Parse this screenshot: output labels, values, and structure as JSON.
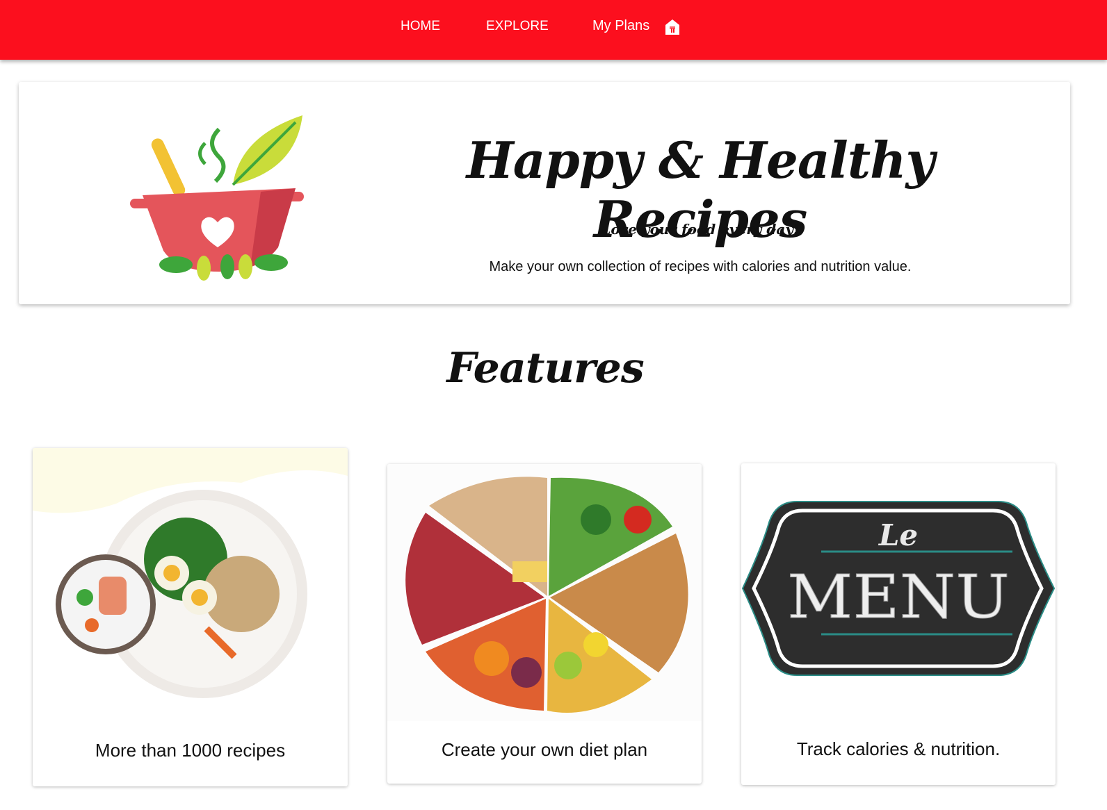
{
  "nav": {
    "items": [
      {
        "label": "HOME"
      },
      {
        "label": "EXPLORE"
      },
      {
        "label": "My Plans",
        "icon": "home-icon"
      }
    ]
  },
  "hero": {
    "title": "Happy & Healthy Recipes",
    "tagline": "Love your food every day!",
    "description": "Make your own collection of recipes with calories and nutrition value."
  },
  "features": {
    "heading": "Features",
    "cards": [
      {
        "caption": "More than 1000 recipes",
        "image": "healthy-bowl-image"
      },
      {
        "caption": "Create your own diet plan",
        "image": "food-groups-image"
      },
      {
        "caption": "Track calories & nutrition.",
        "image": "le-menu-chalkboard-image",
        "image_text": "Le MENU"
      }
    ]
  },
  "colors": {
    "nav": "#fc0f1e",
    "pot": "#e4555b",
    "leaf": "#3ea63b"
  }
}
